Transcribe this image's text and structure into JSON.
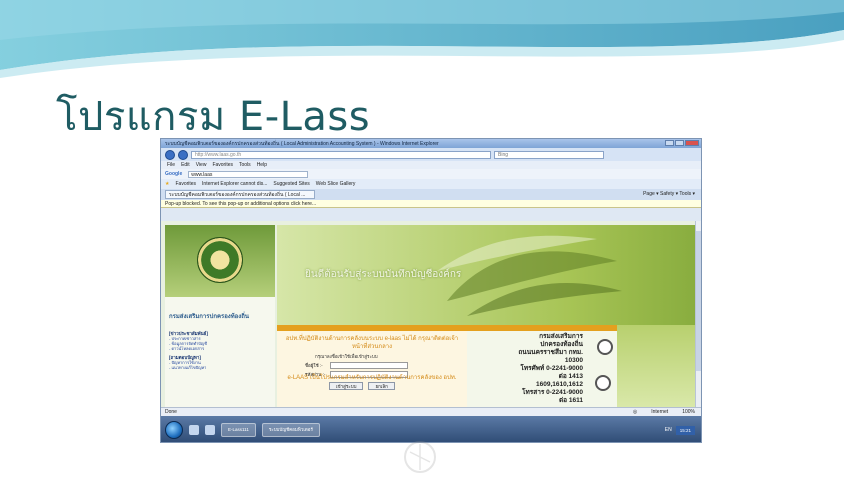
{
  "slide": {
    "title": "โปรแกรม E-Lass"
  },
  "browser": {
    "window_title": "ระบบบัญชีคอมพิวเตอร์ขององค์กรปกครองส่วนท้องถิ่น ( Local Administration Accounting System ) - Windows Internet Explorer",
    "url": "http://www.laas.go.th",
    "search_placeholder": "Bing",
    "menu": [
      "File",
      "Edit",
      "View",
      "Favorites",
      "Tools",
      "Help"
    ],
    "google_label": "Google",
    "google_query": "www.laas",
    "favorites_label": "Favorites",
    "fav_links": [
      "Internet Explorer cannot dis...",
      "Suggested Sites",
      "Web Slice Gallery"
    ],
    "tab_title": "ระบบบัญชีคอมพิวเตอร์ขององค์กรปกครองส่วนท้องถิ่น ( Local ...",
    "tab_tools": "Page ▾  Safety ▾  Tools ▾",
    "info_bar": "Pop-up blocked. To see this pop-up or additional options click here...",
    "status_left": "Done",
    "status_zone": "Internet",
    "status_zoom": "100%"
  },
  "page": {
    "banner_text": "ยินดีต้อนรับสู่ระบบบันทึกบัญชีองค์กร",
    "dept_name": "กรมส่งเสริมการปกครองท้องถิ่น",
    "left_links": {
      "heading1": "[ข่าวประชาสัมพันธ์]",
      "items1": [
        "- ประกาศ/ข่าวสาร",
        "- ข้อมูลการจัดทำบัญชี",
        "- ดาวน์โหลดเอกสาร"
      ],
      "heading2": "[ถามตอบปัญหา]",
      "items2": [
        "- ปัญหาการใช้งาน",
        "- แนวทางแก้ไขปัญหา"
      ]
    },
    "notice": "อปท.ที่ปฏิบัติงานด้านการคลังบนระบบ e-laas ไม่ได้ กรุณาติดต่อเจ้าหน้าที่ส่วนกลาง",
    "login_prompt": "กรุณาลงชื่อเข้าใช้เพื่อเข้าสู่ระบบ",
    "username_label": "ชื่อผู้ใช้ :-",
    "password_label": "รหัสผ่าน :-",
    "login_button": "เข้าสู่ระบบ",
    "cancel_button": "ยกเลิก",
    "elaas_text": "e-LAAS เป็นโปรแกรมสำหรับการปฏิบัติงานด้านการคลังของ อปท.",
    "contact": {
      "org": "กรมส่งเสริมการ",
      "org2": "ปกครองท้องถิ่น",
      "addr": "ถนนนครราชสีมา กทม.",
      "zip": "10300",
      "tel": "โทรศัพท์ 0-2241-9000",
      "ext1": "ต่อ 1413",
      "ext2": "1609,1610,1612",
      "fax": "โทรสาร 0-2241-9000",
      "ext3": "ต่อ 1611"
    }
  },
  "taskbar": {
    "items": [
      "E-Lass111",
      "ระบบบัญชีคอมพิวเตอร์"
    ],
    "lang": "EN",
    "clock": "15:21"
  },
  "colors": {
    "title": "#1f5c63",
    "notice": "#d48a16",
    "banner": "#a7c455"
  }
}
